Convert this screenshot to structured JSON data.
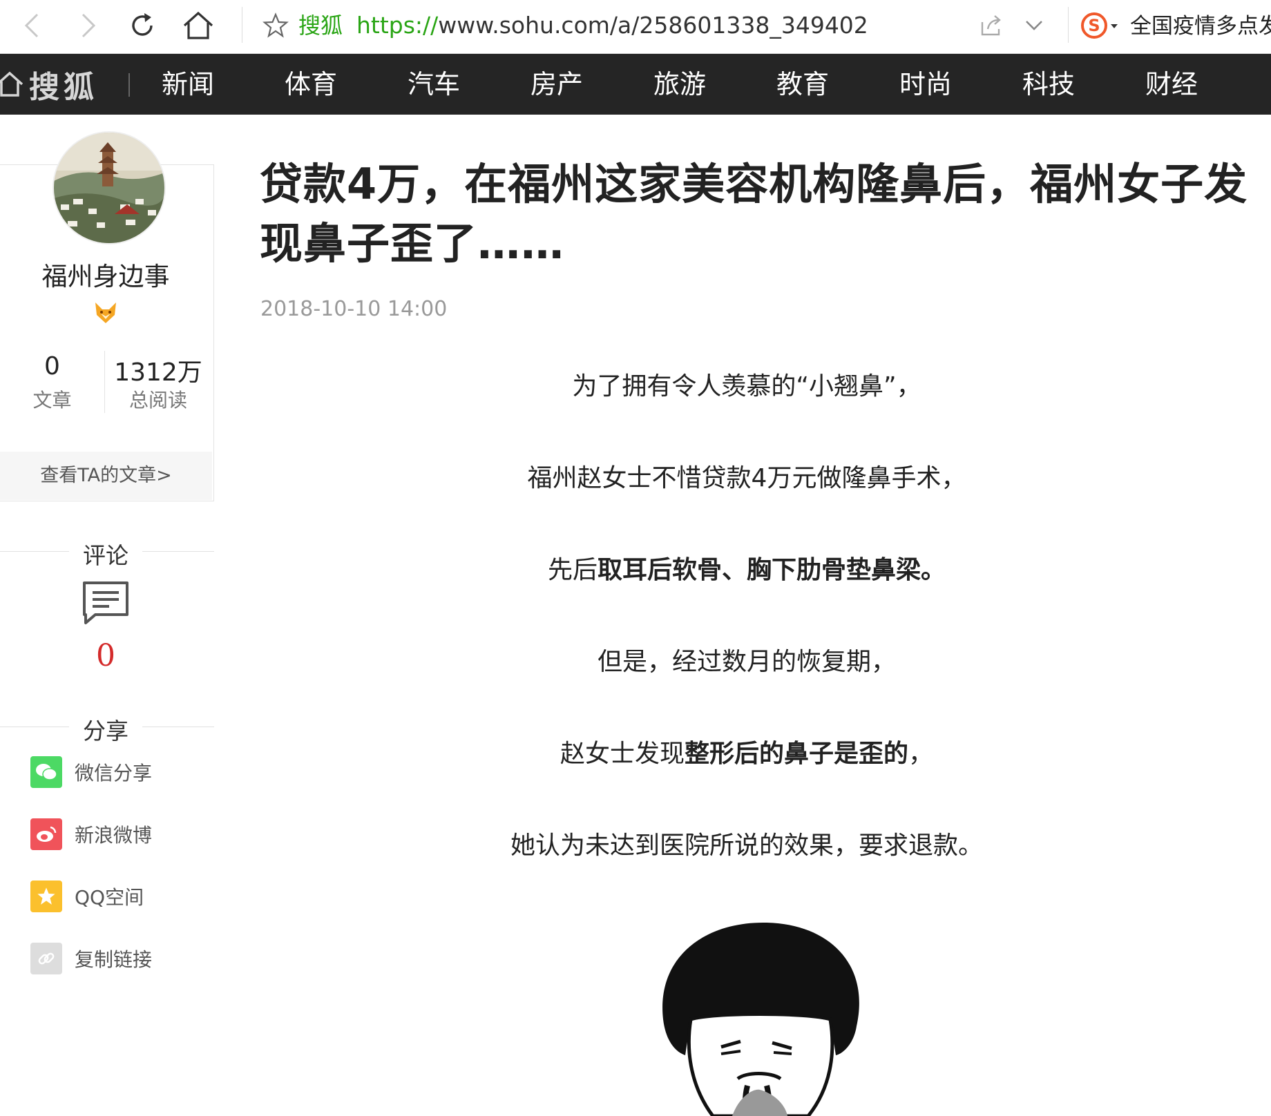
{
  "browser": {
    "site_label": "搜狐",
    "url_protocol": "https://",
    "url_rest": "www.sohu.com/a/258601338_349402",
    "notice": "全国疫情多点发"
  },
  "nav": {
    "logo_text": "搜狐",
    "items": [
      "新闻",
      "体育",
      "汽车",
      "房产",
      "旅游",
      "教育",
      "时尚",
      "科技",
      "财经"
    ]
  },
  "author": {
    "name": "福州身边事",
    "articles_count": "0",
    "articles_label": "文章",
    "reads_count": "1312万",
    "reads_label": "总阅读",
    "view_articles": "查看TA的文章>"
  },
  "comments": {
    "heading": "评论",
    "count": "0"
  },
  "share": {
    "heading": "分享",
    "items": [
      {
        "label": "微信分享",
        "color": "#4cd964"
      },
      {
        "label": "新浪微博",
        "color": "#f0535a"
      },
      {
        "label": "QQ空间",
        "color": "#fbc02d"
      },
      {
        "label": "复制链接",
        "color": "#dddddd"
      }
    ]
  },
  "article": {
    "title": "贷款4万，在福州这家美容机构隆鼻后，福州女子发现鼻子歪了……",
    "time": "2018-10-10 14:00",
    "p1": "为了拥有令人羡慕的“小翘鼻”，",
    "p2": "福州赵女士不惜贷款4万元做隆鼻手术，",
    "p3_a": "先后",
    "p3_b": "取耳后软骨、胸下肋骨垫鼻梁。",
    "p4": "但是，经过数月的恢复期，",
    "p5_a": "赵女士发现",
    "p5_b": "整形后的鼻子是歪的",
    "p5_c": "，",
    "p6": "她认为未达到医院所说的效果，要求退款。"
  }
}
